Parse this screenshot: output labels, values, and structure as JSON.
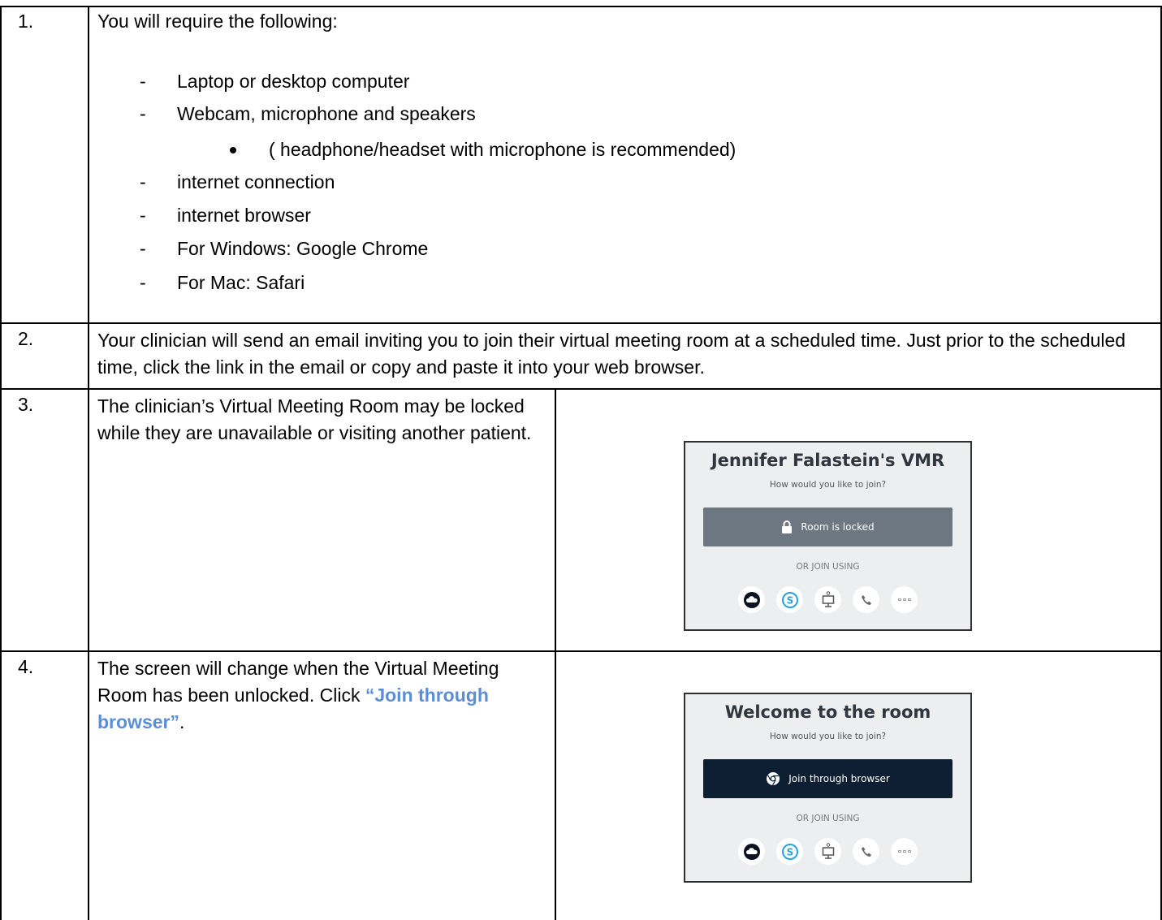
{
  "rows": [
    {
      "number": "1.",
      "intro": "You will require the following:",
      "items": [
        "Laptop or desktop computer",
        "Webcam, microphone and speakers",
        "internet connection",
        "internet browser",
        "For Windows: Google Chrome",
        "For Mac:  Safari"
      ],
      "sub_item": "( headphone/headset with microphone is recommended)"
    },
    {
      "number": "2.",
      "text": "Your clinician will send an email inviting you to join their virtual meeting room at a scheduled time.  Just prior to the scheduled time, click the link in the email or copy and paste it into your web browser."
    },
    {
      "number": "3.",
      "text": "The clinician’s Virtual Meeting Room may be locked while they are unavailable or visiting another patient.",
      "panel": {
        "title": "Jennifer Falastein's VMR",
        "subtitle": "How would you like to join?",
        "button": "Room is locked",
        "or_text": "OR JOIN USING",
        "icons": [
          "cloud-icon",
          "skype-icon",
          "desktop-icon",
          "phone-icon",
          "more-icon"
        ]
      }
    },
    {
      "number": "4.",
      "text_part1": "The screen will change when the Virtual Meeting Room has been unlocked.  Click",
      "link_text": "“Join through browser”",
      "text_part2": ".",
      "panel": {
        "title": "Welcome to the room",
        "subtitle": "How would you like to join?",
        "button": "Join through browser",
        "or_text": "OR JOIN USING",
        "icons": [
          "cloud-icon",
          "skype-icon",
          "desktop-icon",
          "phone-icon",
          "more-icon"
        ]
      }
    }
  ],
  "colors": {
    "link": "#5b8ed6",
    "locked_button": "#6c7782",
    "join_button": "#0f1f33",
    "panel_bg": "#eceeef"
  }
}
